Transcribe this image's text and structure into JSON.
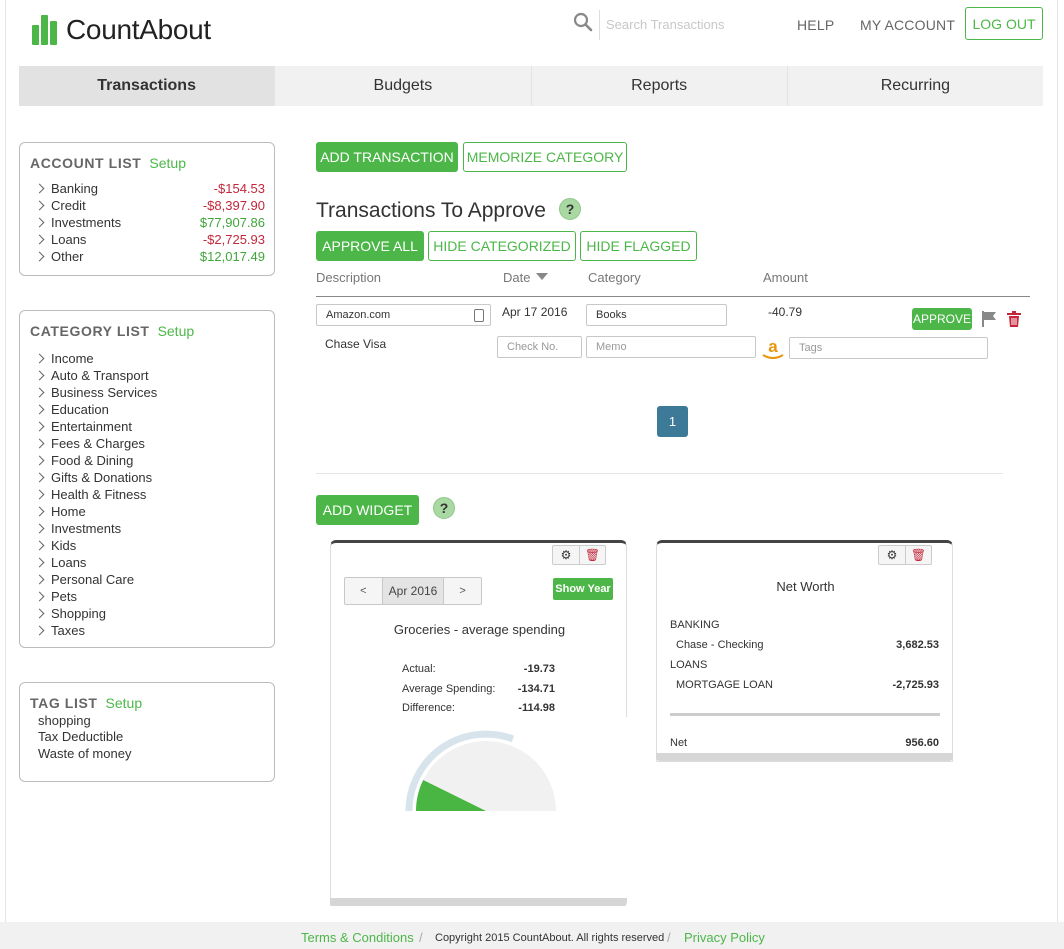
{
  "app": {
    "logo_text": "CountAbout"
  },
  "header": {
    "search_placeholder": "Search Transactions",
    "help": "HELP",
    "my_account": "MY ACCOUNT",
    "logout": "LOG OUT"
  },
  "nav": {
    "tabs": [
      "Transactions",
      "Budgets",
      "Reports",
      "Recurring"
    ],
    "active": "Transactions"
  },
  "account_list": {
    "title": "ACCOUNT LIST",
    "setup": "Setup",
    "items": [
      {
        "name": "Banking",
        "amount": "-$154.53",
        "status": "negative"
      },
      {
        "name": "Credit",
        "amount": "-$8,397.90",
        "status": "negative"
      },
      {
        "name": "Investments",
        "amount": "$77,907.86",
        "status": "positive"
      },
      {
        "name": "Loans",
        "amount": "-$2,725.93",
        "status": "negative"
      },
      {
        "name": "Other",
        "amount": "$12,017.49",
        "status": "positive"
      }
    ]
  },
  "category_list": {
    "title": "CATEGORY LIST",
    "setup": "Setup",
    "items": [
      "Income",
      "Auto & Transport",
      "Business Services",
      "Education",
      "Entertainment",
      "Fees & Charges",
      "Food & Dining",
      "Gifts & Donations",
      "Health & Fitness",
      "Home",
      "Investments",
      "Kids",
      "Loans",
      "Personal Care",
      "Pets",
      "Shopping",
      "Taxes"
    ]
  },
  "tag_list": {
    "title": "TAG LIST",
    "setup": "Setup",
    "items": [
      "shopping",
      "Tax Deductible",
      "Waste of money"
    ]
  },
  "actions": {
    "add_transaction": "ADD TRANSACTION",
    "memorize_category": "MEMORIZE CATEGORY"
  },
  "approve": {
    "title": "Transactions To Approve",
    "approve_all": "APPROVE ALL",
    "hide_categorized": "HIDE CATEGORIZED",
    "hide_flagged": "HIDE FLAGGED",
    "columns": [
      "Description",
      "Date",
      "Category",
      "Amount"
    ],
    "row": {
      "description": "Amazon.com",
      "date": "Apr 17 2016",
      "category": "Books",
      "amount": "-40.79",
      "account": "Chase Visa",
      "check_placeholder": "Check No.",
      "memo_placeholder": "Memo",
      "tags_placeholder": "Tags",
      "approve_label": "APPROVE"
    },
    "page": "1"
  },
  "widgets": {
    "add_widget": "ADD WIDGET",
    "groceries": {
      "prev": "<",
      "period": "Apr 2016",
      "next": ">",
      "show_year": "Show Year",
      "title": "Groceries - average spending",
      "rows": [
        {
          "label": "Actual:",
          "value": "-19.73"
        },
        {
          "label": "Average Spending:",
          "value": "-134.71"
        },
        {
          "label": "Difference:",
          "value": "-114.98"
        }
      ],
      "gauge_fraction": 0.146
    },
    "net_worth": {
      "title": "Net Worth",
      "banking_label": "BANKING",
      "banking_account": "Chase - Checking",
      "banking_value": "3,682.53",
      "loans_label": "LOANS",
      "loan_account": "MORTGAGE LOAN",
      "loan_value": "-2,725.93",
      "net_label": "Net",
      "net_value": "956.60"
    }
  },
  "footer": {
    "terms": "Terms & Conditions",
    "copyright": "Copyright 2015 CountAbout. All rights reserved",
    "privacy": "Privacy Policy",
    "sep": "/"
  },
  "colors": {
    "accent": "#4cb748",
    "negative": "#c4273b",
    "pager": "#3d7a98"
  }
}
